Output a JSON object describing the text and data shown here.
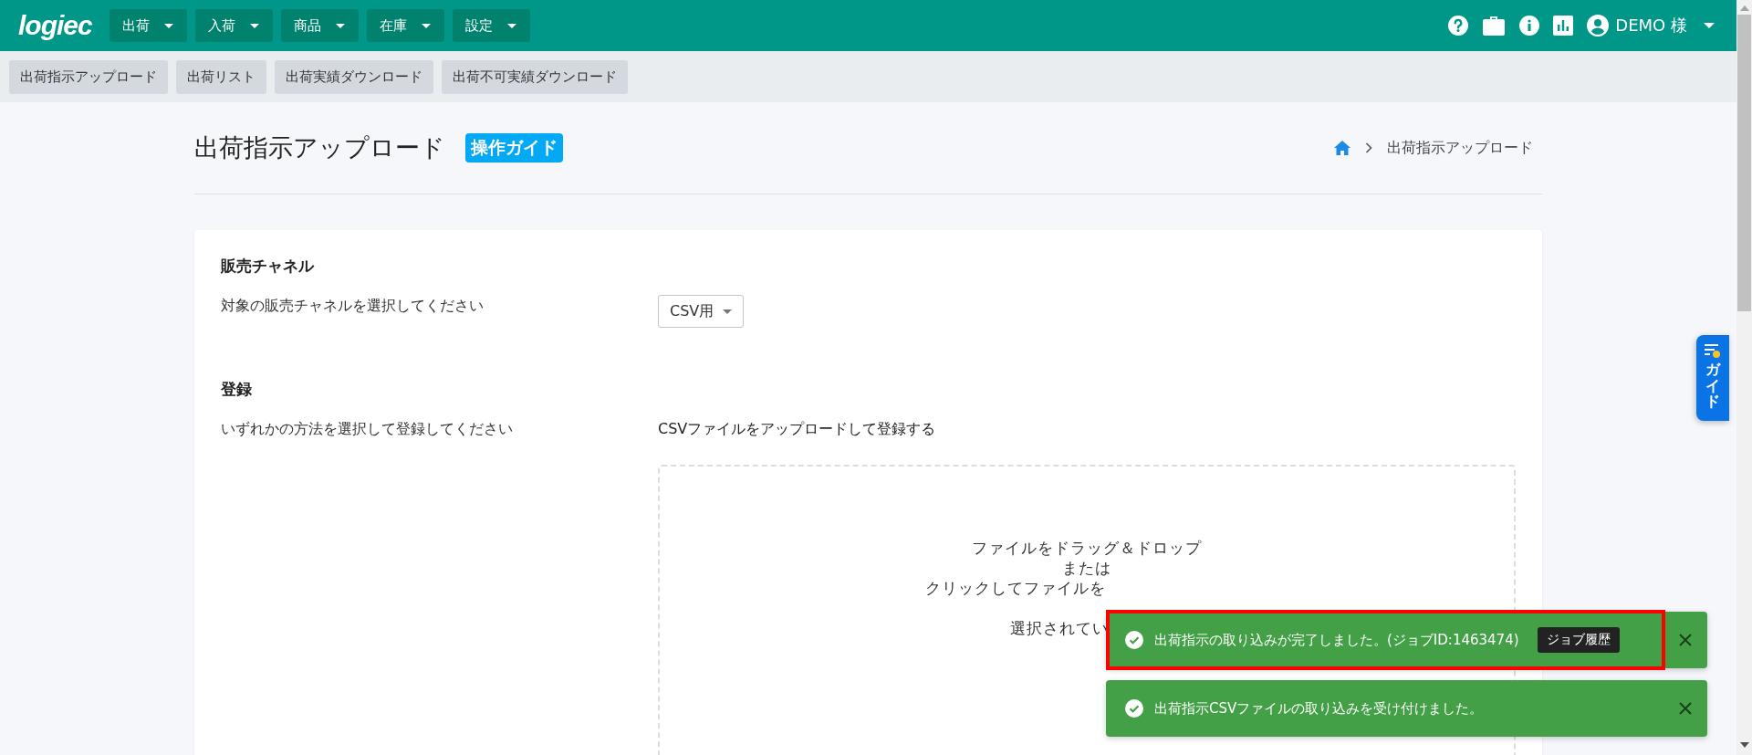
{
  "header": {
    "logo": "logiec",
    "menus": [
      {
        "label": "出荷"
      },
      {
        "label": "入荷"
      },
      {
        "label": "商品"
      },
      {
        "label": "在庫"
      },
      {
        "label": "設定"
      }
    ],
    "user": "DEMO 様"
  },
  "subnav": [
    {
      "label": "出荷指示アップロード"
    },
    {
      "label": "出荷リスト"
    },
    {
      "label": "出荷実績ダウンロード"
    },
    {
      "label": "出荷不可実績ダウンロード"
    }
  ],
  "page": {
    "title": "出荷指示アップロード",
    "guide_badge": "操作ガイド",
    "breadcrumb": [
      "出荷指示アップロード"
    ]
  },
  "sections": [
    {
      "kind": "select",
      "heading": "販売チャネル",
      "label": "対象の販売チャネルを選択してください",
      "value": "CSV用"
    },
    {
      "kind": "upload",
      "heading": "登録",
      "label": "いずれかの方法を選択して登録してください",
      "method": "CSVファイルをアップロードして登録する",
      "dropzone_lines": [
        "ファイルをドラッグ＆ドロップ",
        "または",
        "クリックしてファイルを",
        "選択されてい"
      ]
    }
  ],
  "toasts": [
    {
      "message": "出荷指示の取り込みが完了しました。(ジョブID:1463474)",
      "action": "ジョブ履歴",
      "highlighted": true
    },
    {
      "message": "出荷指示CSVファイルの取り込みを受け付けました。",
      "highlighted": false
    }
  ],
  "guide_tab": "ガイド"
}
